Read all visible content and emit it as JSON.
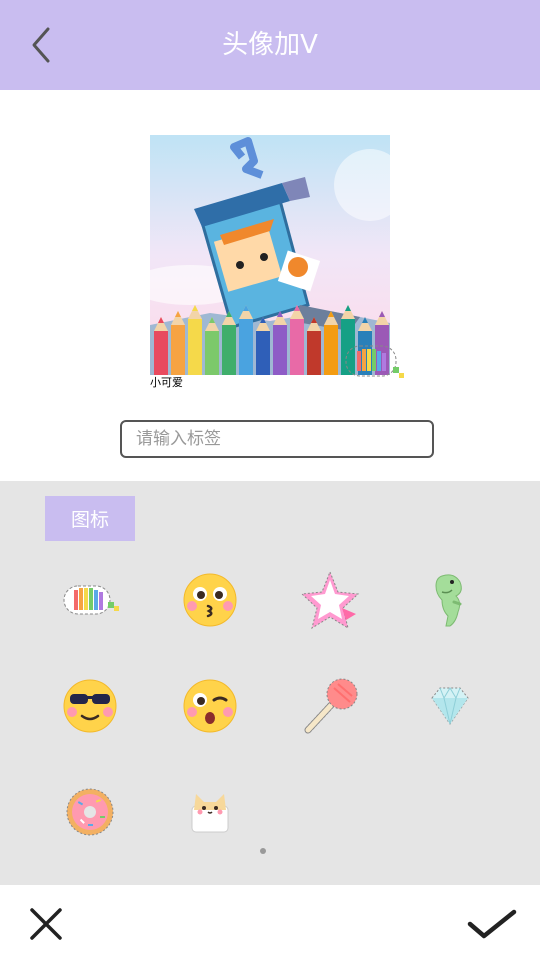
{
  "header": {
    "title": "头像加V",
    "back_icon": "chevron-left-icon"
  },
  "avatar": {
    "caption": "小可爱",
    "picture": "cartoon-character-with-colored-pencils"
  },
  "tag_field": {
    "value": "",
    "placeholder": "请输入标签"
  },
  "sticker_panel": {
    "tab_label": "图标",
    "stickers": [
      "rainbow-cloud-icon",
      "kiss-emoji-icon",
      "star-icon",
      "dinosaur-icon",
      "sunglasses-emoji-icon",
      "wink-emoji-icon",
      "lollipop-icon",
      "diamond-icon",
      "donut-icon",
      "cat-icon"
    ],
    "page_count": 1,
    "current_page": 1
  },
  "footer": {
    "cancel_icon": "close-icon",
    "confirm_icon": "check-icon"
  },
  "colors": {
    "accent": "#c9bdf0",
    "panel_bg": "#e5e5e5",
    "text_white": "#ffffff"
  }
}
